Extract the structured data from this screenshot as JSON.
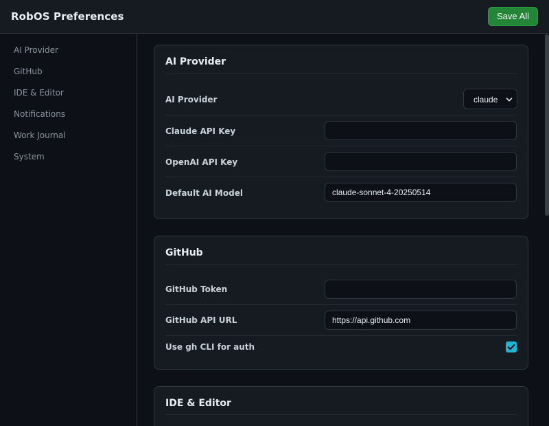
{
  "header": {
    "title": "RobOS Preferences",
    "save_label": "Save All"
  },
  "sidebar": {
    "items": [
      {
        "label": "AI Provider"
      },
      {
        "label": "GitHub"
      },
      {
        "label": "IDE & Editor"
      },
      {
        "label": "Notifications"
      },
      {
        "label": "Work Journal"
      },
      {
        "label": "System"
      }
    ]
  },
  "sections": {
    "ai_provider": {
      "title": "AI Provider",
      "provider_label": "AI Provider",
      "provider_value": "claude",
      "claude_key_label": "Claude API Key",
      "claude_key_value": "",
      "openai_key_label": "OpenAI API Key",
      "openai_key_value": "",
      "model_label": "Default AI Model",
      "model_value": "claude-sonnet-4-20250514"
    },
    "github": {
      "title": "GitHub",
      "token_label": "GitHub Token",
      "token_value": "",
      "api_url_label": "GitHub API URL",
      "api_url_value": "https://api.github.com",
      "gh_cli_label": "Use gh CLI for auth",
      "gh_cli_checked": true
    },
    "ide_editor": {
      "title": "IDE & Editor"
    }
  },
  "colors": {
    "accent_green": "#238636",
    "checkbox_cyan": "#1fb3d4",
    "background": "#0d1117",
    "card": "#161b22"
  }
}
